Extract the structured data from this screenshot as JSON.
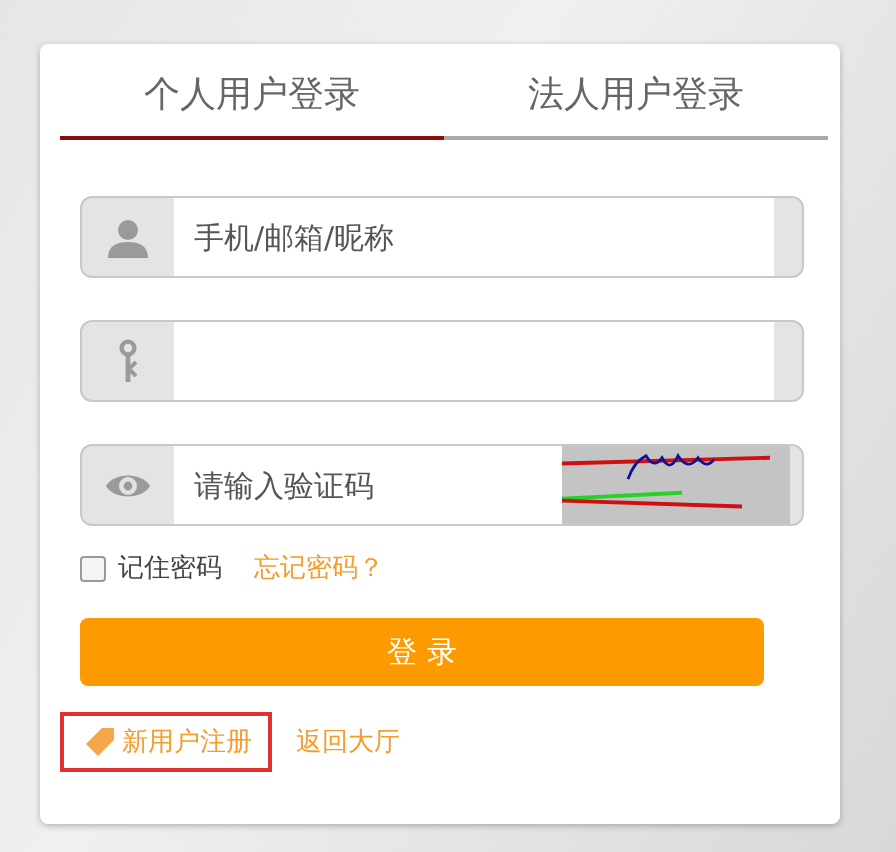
{
  "tabs": [
    {
      "label": "个人用户登录",
      "selected": true
    },
    {
      "label": "法人用户登录",
      "selected": false
    }
  ],
  "fields": [
    {
      "kind": "user",
      "placeholder": "手机/邮箱/昵称"
    },
    {
      "kind": "password"
    },
    {
      "kind": "captcha",
      "placeholder": "请输入验证码"
    }
  ],
  "remember": {
    "label": "记住密码",
    "checked": false
  },
  "forgot_link": "忘记密码？",
  "login_button": "登 录",
  "register_link": {
    "label": "新用户注册",
    "highlighted": true
  },
  "back_link": "返回大厅"
}
